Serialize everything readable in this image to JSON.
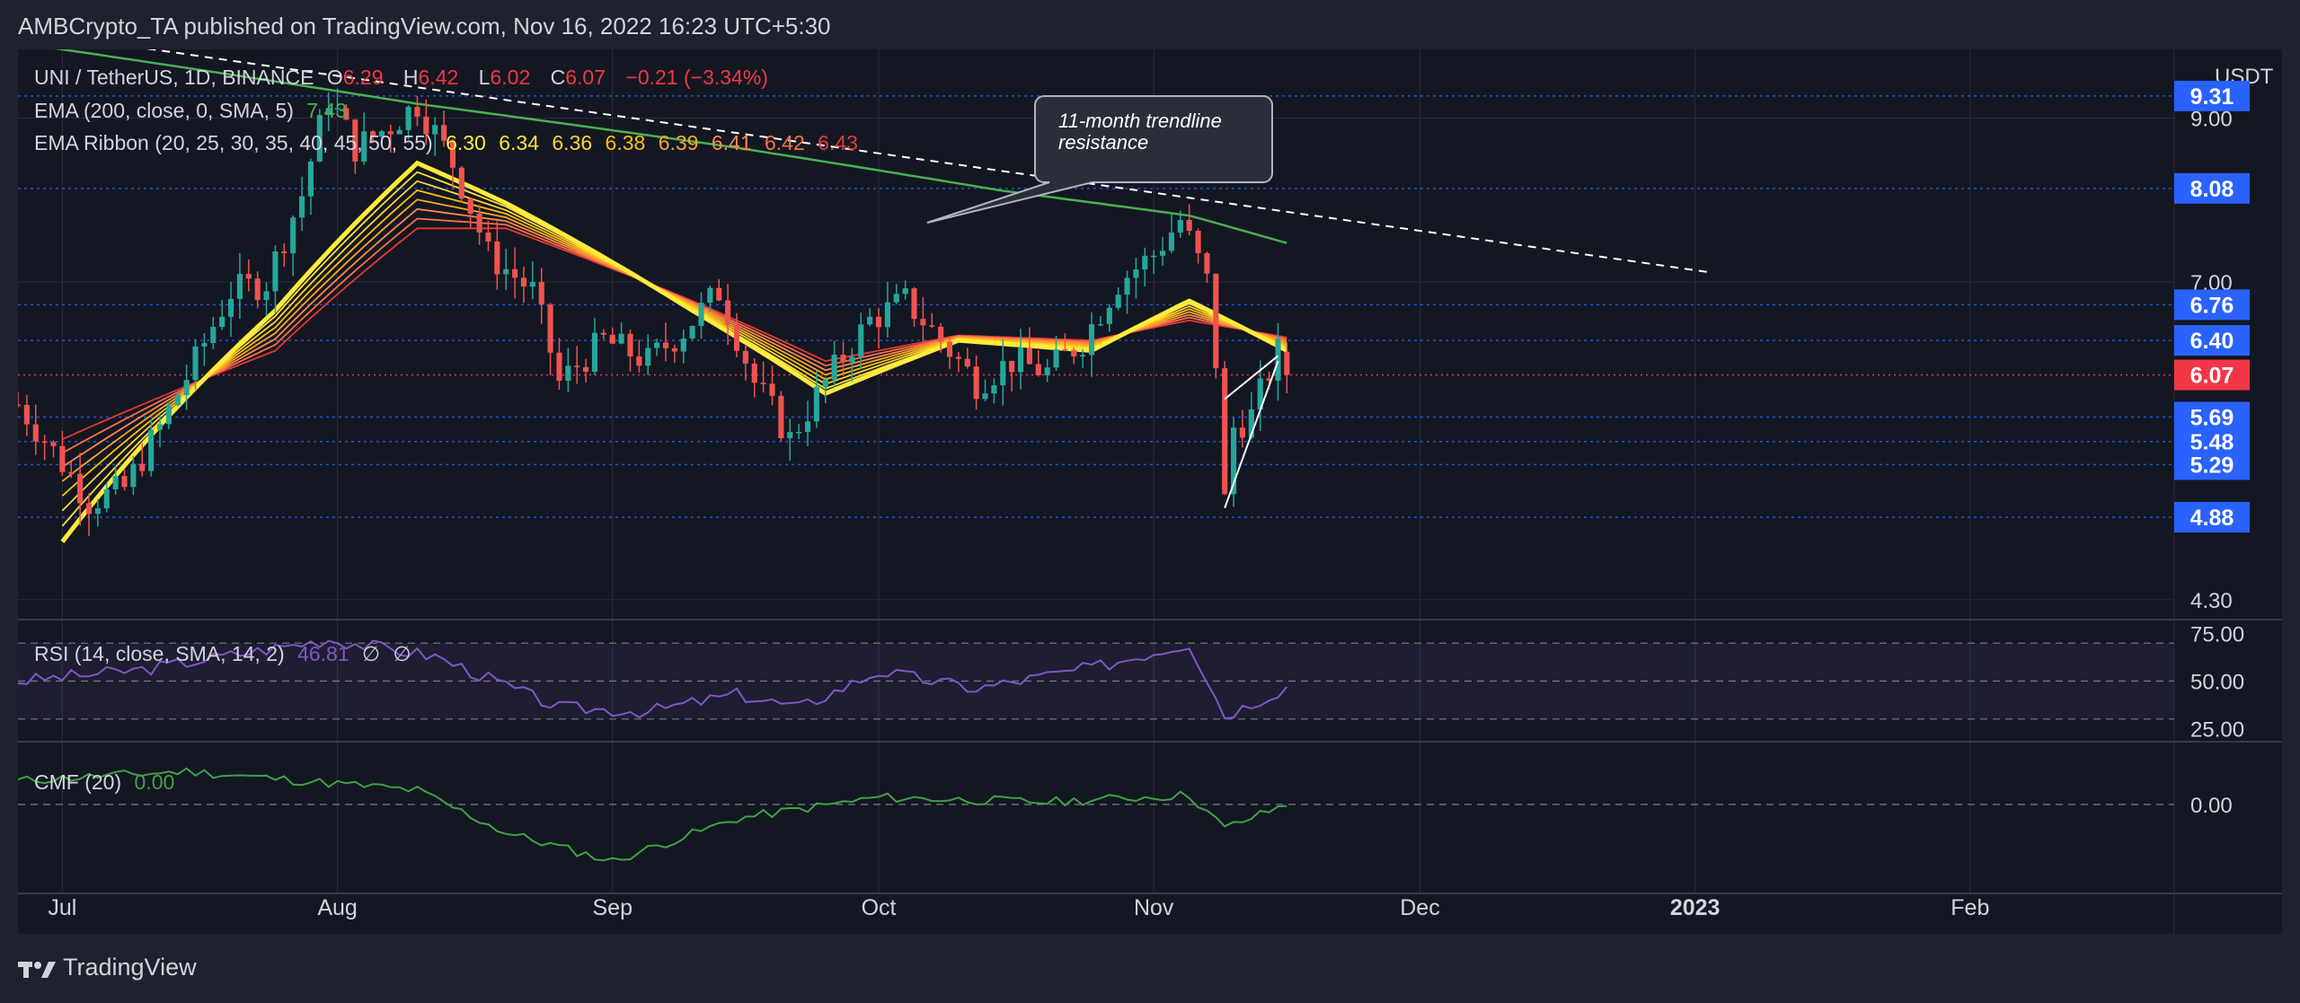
{
  "header": {
    "publish_line": "AMBCrypto_TA published on TradingView.com, Nov 16, 2022 16:23 UTC+5:30"
  },
  "legend": {
    "symbol": "UNI / TetherUS, 1D, BINANCE",
    "o_label": "O",
    "o_value": "6.29",
    "h_label": "H",
    "h_value": "6.42",
    "l_label": "L",
    "l_value": "6.02",
    "c_label": "C",
    "c_value": "6.07",
    "change": "−0.21 (−3.34%)",
    "ema_title": "EMA (200, close, 0, SMA, 5)",
    "ema_value": "7.43",
    "ribbon_title": "EMA Ribbon (20, 25, 30, 35, 40, 45, 50, 55)",
    "ribbon_values": [
      "6.30",
      "6.34",
      "6.36",
      "6.38",
      "6.39",
      "6.41",
      "6.42",
      "6.43"
    ],
    "rsi_title": "RSI (14, close, SMA, 14, 2)",
    "rsi_value": "46.81",
    "rsi_extra1": "∅",
    "rsi_extra2": "∅",
    "cmf_title": "CMF (20)",
    "cmf_value": "0.00"
  },
  "annotation": {
    "line1": "11-month trendline",
    "line2": "resistance"
  },
  "footer": {
    "brand": "TradingView"
  },
  "colors": {
    "background": "#131722",
    "up": "#26a69a",
    "down": "#ef5350",
    "ema200": "#4caf50",
    "ribbon_fast": "#ffeb3b",
    "ribbon_slow": "#e53935",
    "rsi": "#7e57c2",
    "cmf": "#43a047",
    "level_badge": "#2962ff",
    "price_badge": "#f23645"
  },
  "chart_data": [
    {
      "type": "candlestick",
      "title": "UNI / TetherUS, 1D, BINANCE",
      "unit": "USDT",
      "x_ticks": [
        "Jul",
        "Aug",
        "Sep",
        "Oct",
        "Nov",
        "Dec",
        "2023",
        "Feb"
      ],
      "x_tick_dates": [
        "2022-07-01",
        "2022-08-01",
        "2022-09-01",
        "2022-10-01",
        "2022-11-01",
        "2022-12-01",
        "2023-01-01",
        "2023-02-01"
      ],
      "x_range": [
        "2022-06-26",
        "2023-02-24"
      ],
      "y_ticks": [
        4.3,
        7.0,
        9.0
      ],
      "ylim": [
        4.2,
        10.0
      ],
      "log_scale": true,
      "last_price": 6.07,
      "horizontal_levels": [
        9.31,
        8.08,
        6.76,
        6.4,
        5.69,
        5.48,
        5.29,
        4.88
      ],
      "ohlc_anchors": [
        {
          "date": "2022-06-26",
          "close": 5.8
        },
        {
          "date": "2022-07-01",
          "close": 5.3
        },
        {
          "date": "2022-07-04",
          "close": 5.0
        },
        {
          "date": "2022-07-08",
          "close": 5.1
        },
        {
          "date": "2022-07-12",
          "close": 5.6
        },
        {
          "date": "2022-07-16",
          "close": 6.2
        },
        {
          "date": "2022-07-20",
          "close": 6.9
        },
        {
          "date": "2022-07-24",
          "close": 7.0
        },
        {
          "date": "2022-07-28",
          "close": 8.0
        },
        {
          "date": "2022-07-31",
          "close": 9.3
        },
        {
          "date": "2022-08-03",
          "close": 8.6
        },
        {
          "date": "2022-08-07",
          "close": 8.9
        },
        {
          "date": "2022-08-10",
          "close": 9.2
        },
        {
          "date": "2022-08-14",
          "close": 8.4
        },
        {
          "date": "2022-08-18",
          "close": 7.3
        },
        {
          "date": "2022-08-23",
          "close": 6.9
        },
        {
          "date": "2022-08-26",
          "close": 6.0
        },
        {
          "date": "2022-08-31",
          "close": 6.4
        },
        {
          "date": "2022-09-05",
          "close": 6.2
        },
        {
          "date": "2022-09-09",
          "close": 6.5
        },
        {
          "date": "2022-09-13",
          "close": 6.9
        },
        {
          "date": "2022-09-17",
          "close": 6.0
        },
        {
          "date": "2022-09-21",
          "close": 5.5
        },
        {
          "date": "2022-09-25",
          "close": 6.0
        },
        {
          "date": "2022-09-30",
          "close": 6.6
        },
        {
          "date": "2022-10-04",
          "close": 6.8
        },
        {
          "date": "2022-10-08",
          "close": 6.4
        },
        {
          "date": "2022-10-12",
          "close": 6.0
        },
        {
          "date": "2022-10-16",
          "close": 6.2
        },
        {
          "date": "2022-10-20",
          "close": 6.1
        },
        {
          "date": "2022-10-24",
          "close": 6.4
        },
        {
          "date": "2022-10-28",
          "close": 7.0
        },
        {
          "date": "2022-11-01",
          "close": 7.3
        },
        {
          "date": "2022-11-04",
          "close": 7.7
        },
        {
          "date": "2022-11-07",
          "close": 7.0
        },
        {
          "date": "2022-11-08",
          "close": 6.2
        },
        {
          "date": "2022-11-09",
          "close": 5.0
        },
        {
          "date": "2022-11-10",
          "close": 5.6
        },
        {
          "date": "2022-11-12",
          "close": 5.7
        },
        {
          "date": "2022-11-14",
          "close": 6.1
        },
        {
          "date": "2022-11-15",
          "close": 6.29
        },
        {
          "date": "2022-11-16",
          "close": 6.07
        }
      ],
      "ema200_series": [
        {
          "date": "2022-06-26",
          "value": 10.1
        },
        {
          "date": "2022-08-10",
          "value": 9.2
        },
        {
          "date": "2022-09-15",
          "value": 8.6
        },
        {
          "date": "2022-10-15",
          "value": 8.05
        },
        {
          "date": "2022-11-05",
          "value": 7.75
        },
        {
          "date": "2022-11-16",
          "value": 7.43
        }
      ],
      "ema_ribbon_fast": [
        {
          "date": "2022-07-01",
          "value": 4.7
        },
        {
          "date": "2022-07-25",
          "value": 6.7
        },
        {
          "date": "2022-08-10",
          "value": 8.4
        },
        {
          "date": "2022-08-20",
          "value": 7.9
        },
        {
          "date": "2022-09-10",
          "value": 6.7
        },
        {
          "date": "2022-09-25",
          "value": 5.9
        },
        {
          "date": "2022-10-10",
          "value": 6.4
        },
        {
          "date": "2022-10-25",
          "value": 6.3
        },
        {
          "date": "2022-11-05",
          "value": 6.8
        },
        {
          "date": "2022-11-16",
          "value": 6.3
        }
      ],
      "ema_ribbon_slow": [
        {
          "date": "2022-07-01",
          "value": 5.5
        },
        {
          "date": "2022-07-25",
          "value": 6.3
        },
        {
          "date": "2022-08-10",
          "value": 7.6
        },
        {
          "date": "2022-08-20",
          "value": 7.6
        },
        {
          "date": "2022-09-10",
          "value": 6.8
        },
        {
          "date": "2022-09-25",
          "value": 6.2
        },
        {
          "date": "2022-10-10",
          "value": 6.45
        },
        {
          "date": "2022-10-25",
          "value": 6.4
        },
        {
          "date": "2022-11-05",
          "value": 6.6
        },
        {
          "date": "2022-11-16",
          "value": 6.43
        }
      ],
      "trendline": [
        {
          "date": "2022-07-01",
          "value": 10.2
        },
        {
          "date": "2023-01-03",
          "value": 7.1
        }
      ],
      "pattern_lines": [
        [
          {
            "date": "2022-11-09",
            "value": 4.95
          },
          {
            "date": "2022-11-15",
            "value": 6.2
          }
        ],
        [
          {
            "date": "2022-11-09",
            "value": 5.85
          },
          {
            "date": "2022-11-15",
            "value": 6.25
          }
        ]
      ],
      "annotation": "11-month trendline resistance"
    },
    {
      "type": "line",
      "title": "RSI (14, close, SMA, 14, 2)",
      "ylim": [
        20,
        80
      ],
      "y_ticks": [
        25.0,
        50.0,
        75.0
      ],
      "band": [
        30,
        70
      ],
      "last_value": 46.81,
      "series": [
        {
          "values": [
            {
              "date": "2022-06-26",
              "value": 50
            },
            {
              "date": "2022-07-10",
              "value": 56
            },
            {
              "date": "2022-07-31",
              "value": 72
            },
            {
              "date": "2022-08-12",
              "value": 63
            },
            {
              "date": "2022-08-26",
              "value": 36
            },
            {
              "date": "2022-09-05",
              "value": 34
            },
            {
              "date": "2022-09-15",
              "value": 43
            },
            {
              "date": "2022-09-22",
              "value": 36
            },
            {
              "date": "2022-10-01",
              "value": 55
            },
            {
              "date": "2022-10-12",
              "value": 46
            },
            {
              "date": "2022-10-26",
              "value": 58
            },
            {
              "date": "2022-11-05",
              "value": 70
            },
            {
              "date": "2022-11-09",
              "value": 32
            },
            {
              "date": "2022-11-16",
              "value": 46.81
            }
          ]
        }
      ]
    },
    {
      "type": "line",
      "title": "CMF (20)",
      "ylim": [
        -0.3,
        0.25
      ],
      "y_ticks": [
        0.0
      ],
      "last_value": 0.0,
      "series": [
        {
          "values": [
            {
              "date": "2022-06-26",
              "value": 0.1
            },
            {
              "date": "2022-07-15",
              "value": 0.14
            },
            {
              "date": "2022-08-10",
              "value": 0.06
            },
            {
              "date": "2022-08-20",
              "value": -0.12
            },
            {
              "date": "2022-09-01",
              "value": -0.24
            },
            {
              "date": "2022-09-15",
              "value": -0.06
            },
            {
              "date": "2022-10-01",
              "value": 0.03
            },
            {
              "date": "2022-10-20",
              "value": 0.01
            },
            {
              "date": "2022-11-05",
              "value": 0.04
            },
            {
              "date": "2022-11-09",
              "value": -0.1
            },
            {
              "date": "2022-11-16",
              "value": 0.0
            }
          ]
        }
      ]
    }
  ]
}
